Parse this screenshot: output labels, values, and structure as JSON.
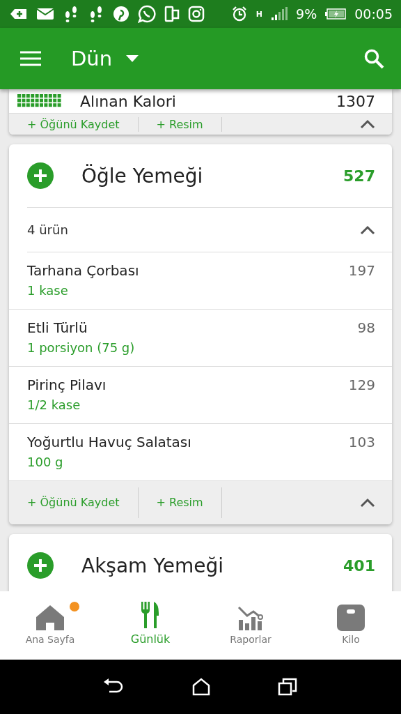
{
  "status_bar": {
    "battery": "9%",
    "network": "H",
    "time": "00:05"
  },
  "app_bar": {
    "title": "Dün"
  },
  "summary": {
    "label": "Alınan Kalori",
    "value": "1307",
    "actions": [
      "+ Öğünü Kaydet",
      "+ Resim"
    ],
    "expanded": true
  },
  "meals": [
    {
      "name": "Öğle Yemeği",
      "calories": "527",
      "count": "4 ürün",
      "expanded": true,
      "items": [
        {
          "name": "Tarhana Çorbası",
          "amount": "1  kase",
          "calories": "197"
        },
        {
          "name": "Etli Türlü",
          "amount": "1  porsiyon (75 g)",
          "calories": "98"
        },
        {
          "name": "Pirinç Pilavı",
          "amount": "1/2 kase",
          "calories": "129"
        },
        {
          "name": "Yoğurtlu Havuç Salatası",
          "amount": "100  g",
          "calories": "103"
        }
      ],
      "actions": [
        "+ Öğünü Kaydet",
        "+ Resim"
      ]
    },
    {
      "name": "Akşam Yemeği",
      "calories": "401"
    }
  ],
  "bottom_nav": [
    {
      "label": "Ana Sayfa",
      "kind": "home",
      "selected": false,
      "badge": true
    },
    {
      "label": "Günlük",
      "kind": "diary",
      "selected": true,
      "badge": false
    },
    {
      "label": "Raporlar",
      "kind": "reports",
      "selected": false,
      "badge": false
    },
    {
      "label": "Kilo",
      "kind": "weight",
      "selected": false,
      "badge": false
    }
  ]
}
